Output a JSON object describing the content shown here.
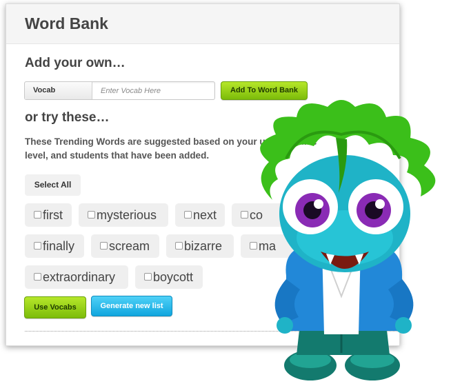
{
  "panel": {
    "title": "Word Bank",
    "add_heading": "Add your own…",
    "vocab_label": "Vocab",
    "vocab_placeholder": "Enter Vocab Here",
    "add_button": "Add To Word Bank",
    "try_heading": "or try these…",
    "description": "These Trending Words are suggested based on your usage, grade level, and students that have been added.",
    "select_all": "Select All",
    "words": [
      "first",
      "mysterious",
      "next",
      "co",
      "finally",
      "scream",
      "bizarre",
      "ma",
      "extraordinary",
      "boycott"
    ],
    "use_button": "Use Vocabs",
    "generate_button": "Generate new list"
  },
  "colors": {
    "green_button": "#8ccf14",
    "blue_button": "#1ab4e6",
    "monster_hair": "#3bbf1a",
    "monster_skin": "#1fb3c7",
    "monster_jacket": "#2288d8",
    "monster_eye": "#8a2bb5"
  },
  "icons": {
    "mascot": "green-haired-monster-mascot"
  }
}
